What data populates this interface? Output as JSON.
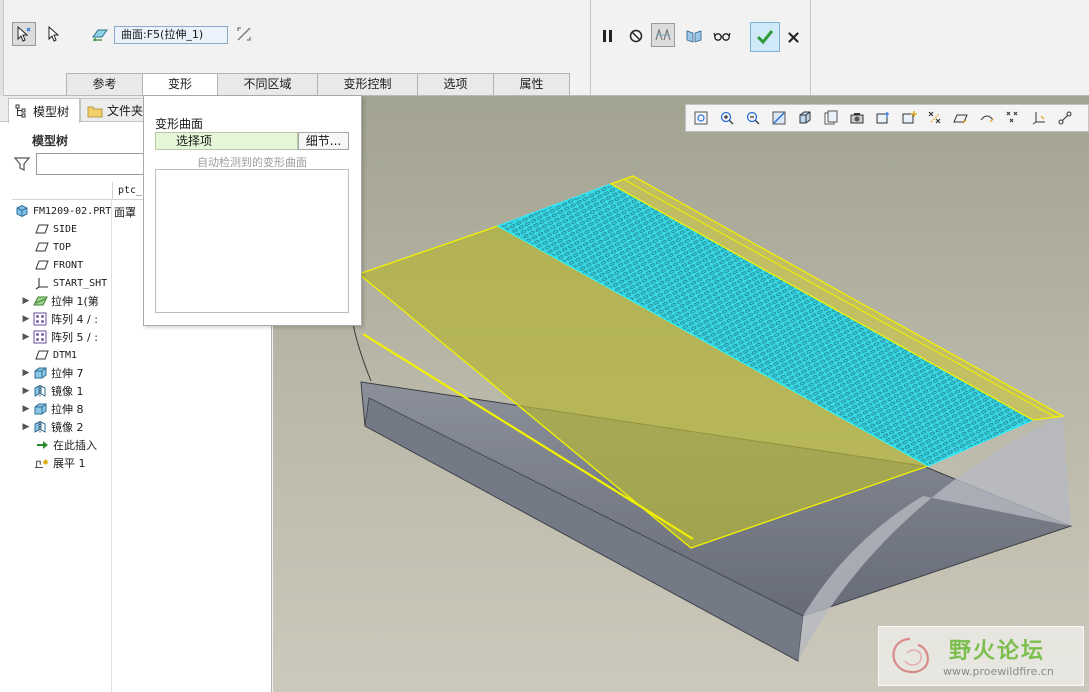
{
  "dashboard": {
    "surface_collector": "曲面:F5(拉伸_1)",
    "tabs": [
      {
        "label": "参考"
      },
      {
        "label": "变形"
      },
      {
        "label": "不同区域"
      },
      {
        "label": "变形控制"
      },
      {
        "label": "选项"
      },
      {
        "label": "属性"
      }
    ],
    "active_tab": "变形"
  },
  "deform_panel": {
    "section_title": "变形曲面",
    "collector_label": "选择项",
    "details_button": "细节...",
    "auto_detect_label": "自动检测到的变形曲面"
  },
  "navigator": {
    "tabs": [
      "模型树",
      "文件夹"
    ],
    "tree_title": "模型树",
    "column_header": "ptc_",
    "items": [
      {
        "label": "FM1209-02.PRT",
        "icon": "part-icon",
        "expandable": false,
        "indent": 0,
        "col2": "面罩"
      },
      {
        "label": "SIDE",
        "icon": "datum-plane-icon",
        "expandable": false,
        "indent": 1
      },
      {
        "label": "TOP",
        "icon": "datum-plane-icon",
        "expandable": false,
        "indent": 1
      },
      {
        "label": "FRONT",
        "icon": "datum-plane-icon",
        "expandable": false,
        "indent": 1
      },
      {
        "label": "START_SHT",
        "icon": "coord-sys-icon",
        "expandable": false,
        "indent": 1
      },
      {
        "label": "拉伸 1(第",
        "icon": "extrude-surface-icon",
        "expandable": true,
        "indent": 1
      },
      {
        "label": "阵列 4 / :",
        "icon": "pattern-icon",
        "expandable": true,
        "indent": 1
      },
      {
        "label": "阵列 5 / :",
        "icon": "pattern-icon",
        "expandable": true,
        "indent": 1
      },
      {
        "label": "DTM1",
        "icon": "datum-plane-icon",
        "expandable": false,
        "indent": 1
      },
      {
        "label": "拉伸 7",
        "icon": "extrude-icon",
        "expandable": true,
        "indent": 1
      },
      {
        "label": "镜像 1",
        "icon": "mirror-icon",
        "expandable": true,
        "indent": 1
      },
      {
        "label": "拉伸 8",
        "icon": "extrude-icon",
        "expandable": true,
        "indent": 1
      },
      {
        "label": "镜像 2",
        "icon": "mirror-icon",
        "expandable": true,
        "indent": 1
      },
      {
        "label": "在此插入",
        "icon": "insert-here-icon",
        "expandable": false,
        "indent": 1
      },
      {
        "label": "展平 1",
        "icon": "flatten-icon",
        "expandable": false,
        "indent": 1
      }
    ]
  },
  "watermark": {
    "title": "野火论坛",
    "url": "www.proewildfire.cn"
  },
  "colors": {
    "accent_check": "#2e9a3a",
    "surface_yellow": "#b4b43a",
    "surface_cyan": "#35d7e6",
    "model_gray": "#6f7480"
  }
}
